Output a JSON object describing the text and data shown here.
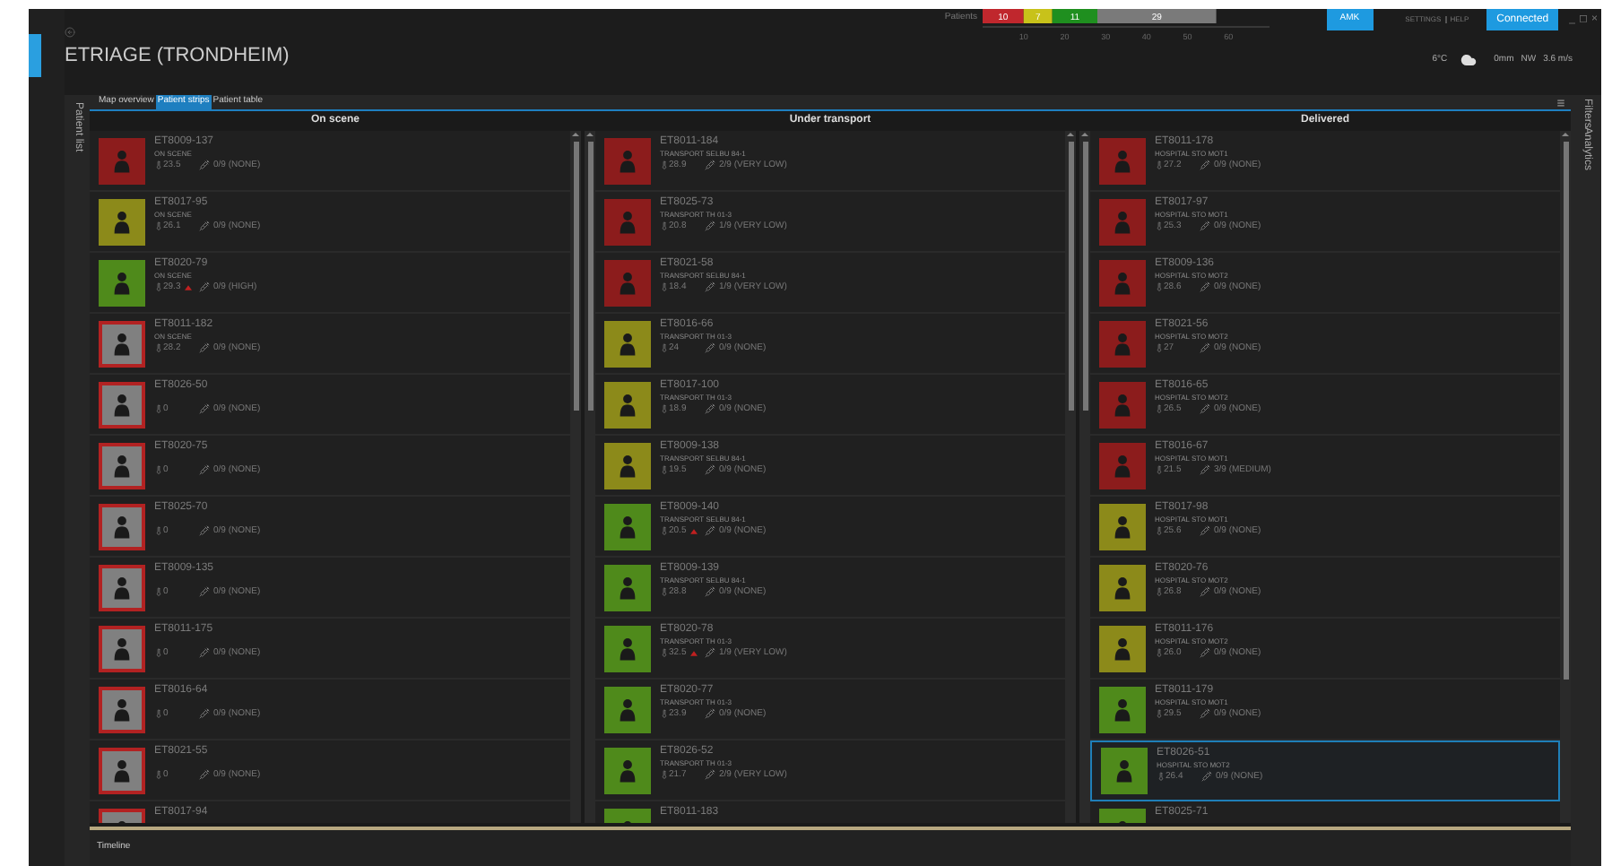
{
  "header": {
    "title": "ETRIAGE (TRONDHEIM)",
    "chart_data": {
      "type": "bar",
      "orientation": "horizontal",
      "stacked": true,
      "data_labels": true,
      "categories": [
        "Patients"
      ],
      "xlim": [
        0,
        70
      ],
      "xticks": [
        10,
        20,
        30,
        40,
        50,
        60
      ],
      "series": [
        {
          "color": "#c0272d",
          "values": [
            10
          ]
        },
        {
          "color": "#c8c21a",
          "values": [
            7
          ]
        },
        {
          "color": "#1f8f1f",
          "values": [
            11
          ]
        },
        {
          "color": "#7a7a7a",
          "values": [
            29
          ]
        }
      ]
    },
    "amk_button": "AMK",
    "links": [
      "SETTINGS",
      "HELP"
    ],
    "connection": "Connected",
    "window_controls": [
      "_",
      "◻",
      "×"
    ],
    "weather": {
      "temperature": "6°C",
      "precipitation": "0mm",
      "wind_direction": "NW",
      "wind_speed": "3.6 m/s"
    }
  },
  "left_side_tabs": [
    "Patient list"
  ],
  "right_side_tabs": [
    "Filters",
    "Analytics"
  ],
  "tabs": [
    {
      "label": "Map overview",
      "selected": false
    },
    {
      "label": "Patient strips",
      "selected": true
    },
    {
      "label": "Patient table",
      "selected": false
    }
  ],
  "columns": [
    {
      "title": "On scene",
      "patients": [
        {
          "id": "ET8009-137",
          "status": "ON SCENE",
          "temp": "23.5",
          "score": "0/9 (NONE)",
          "flagged": false,
          "color": "#8c1c1c",
          "outlined": false,
          "selected": false
        },
        {
          "id": "ET8017-95",
          "status": "ON SCENE",
          "temp": "26.1",
          "score": "0/9 (NONE)",
          "flagged": false,
          "color": "#8c8a1a",
          "outlined": false,
          "selected": false
        },
        {
          "id": "ET8020-79",
          "status": "ON SCENE",
          "temp": "29.3",
          "score": "0/9 (HIGH)",
          "flagged": true,
          "color": "#4f8a1b",
          "outlined": false,
          "selected": false
        },
        {
          "id": "ET8011-182",
          "status": "ON SCENE",
          "temp": "28.2",
          "score": "0/9 (NONE)",
          "flagged": false,
          "color": "#808080",
          "outlined": true,
          "selected": false
        },
        {
          "id": "ET8026-50",
          "temp": "0",
          "score": "0/9 (NONE)",
          "flagged": false,
          "color": "#808080",
          "outlined": true,
          "selected": false
        },
        {
          "id": "ET8020-75",
          "temp": "0",
          "score": "0/9 (NONE)",
          "flagged": false,
          "color": "#808080",
          "outlined": true,
          "selected": false
        },
        {
          "id": "ET8025-70",
          "temp": "0",
          "score": "0/9 (NONE)",
          "flagged": false,
          "color": "#808080",
          "outlined": true,
          "selected": false
        },
        {
          "id": "ET8009-135",
          "temp": "0",
          "score": "0/9 (NONE)",
          "flagged": false,
          "color": "#808080",
          "outlined": true,
          "selected": false
        },
        {
          "id": "ET8011-175",
          "temp": "0",
          "score": "0/9 (NONE)",
          "flagged": false,
          "color": "#808080",
          "outlined": true,
          "selected": false
        },
        {
          "id": "ET8016-64",
          "temp": "0",
          "score": "0/9 (NONE)",
          "flagged": false,
          "color": "#808080",
          "outlined": true,
          "selected": false
        },
        {
          "id": "ET8021-55",
          "temp": "0",
          "score": "0/9 (NONE)",
          "flagged": false,
          "color": "#808080",
          "outlined": true,
          "selected": false
        },
        {
          "id": "ET8017-94",
          "color": "#808080",
          "outlined": true,
          "selected": false
        }
      ]
    },
    {
      "title": "Under transport",
      "patients": [
        {
          "id": "ET8011-184",
          "status": "TRANSPORT SELBU 84-1",
          "temp": "28.9",
          "score": "2/9 (VERY LOW)",
          "flagged": false,
          "color": "#8c1c1c",
          "outlined": false,
          "selected": false
        },
        {
          "id": "ET8025-73",
          "status": "TRANSPORT TH 01-3",
          "temp": "20.8",
          "score": "1/9 (VERY LOW)",
          "flagged": false,
          "color": "#8c1c1c",
          "outlined": false,
          "selected": false
        },
        {
          "id": "ET8021-58",
          "status": "TRANSPORT SELBU 84-1",
          "temp": "18.4",
          "score": "1/9 (VERY LOW)",
          "flagged": false,
          "color": "#8c1c1c",
          "outlined": false,
          "selected": false
        },
        {
          "id": "ET8016-66",
          "status": "TRANSPORT TH 01-3",
          "temp": "24",
          "score": "0/9 (NONE)",
          "flagged": false,
          "color": "#8c8a1a",
          "outlined": false,
          "selected": false
        },
        {
          "id": "ET8017-100",
          "status": "TRANSPORT TH 01-3",
          "temp": "18.9",
          "score": "0/9 (NONE)",
          "flagged": false,
          "color": "#8c8a1a",
          "outlined": false,
          "selected": false
        },
        {
          "id": "ET8009-138",
          "status": "TRANSPORT SELBU 84-1",
          "temp": "19.5",
          "score": "0/9 (NONE)",
          "flagged": false,
          "color": "#8c8a1a",
          "outlined": false,
          "selected": false
        },
        {
          "id": "ET8009-140",
          "status": "TRANSPORT SELBU 84-1",
          "temp": "20.5",
          "score": "0/9 (NONE)",
          "flagged": true,
          "color": "#4f8a1b",
          "outlined": false,
          "selected": false
        },
        {
          "id": "ET8009-139",
          "status": "TRANSPORT SELBU 84-1",
          "temp": "28.8",
          "score": "0/9 (NONE)",
          "flagged": false,
          "color": "#4f8a1b",
          "outlined": false,
          "selected": false
        },
        {
          "id": "ET8020-78",
          "status": "TRANSPORT TH 01-3",
          "temp": "32.5",
          "score": "1/9 (VERY LOW)",
          "flagged": true,
          "color": "#4f8a1b",
          "outlined": false,
          "selected": false
        },
        {
          "id": "ET8020-77",
          "status": "TRANSPORT TH 01-3",
          "temp": "23.9",
          "score": "0/9 (NONE)",
          "flagged": false,
          "color": "#4f8a1b",
          "outlined": false,
          "selected": false
        },
        {
          "id": "ET8026-52",
          "status": "TRANSPORT TH 01-3",
          "temp": "21.7",
          "score": "2/9 (VERY LOW)",
          "flagged": false,
          "color": "#4f8a1b",
          "outlined": false,
          "selected": false
        },
        {
          "id": "ET8011-183",
          "color": "#4f8a1b",
          "outlined": false,
          "selected": false
        }
      ]
    },
    {
      "title": "Delivered",
      "patients": [
        {
          "id": "ET8011-178",
          "status": "HOSPITAL STO MOT1",
          "temp": "27.2",
          "score": "0/9 (NONE)",
          "flagged": false,
          "color": "#8c1c1c",
          "outlined": false,
          "selected": false
        },
        {
          "id": "ET8017-97",
          "status": "HOSPITAL STO MOT1",
          "temp": "25.3",
          "score": "0/9 (NONE)",
          "flagged": false,
          "color": "#8c1c1c",
          "outlined": false,
          "selected": false
        },
        {
          "id": "ET8009-136",
          "status": "HOSPITAL STO MOT2",
          "temp": "28.6",
          "score": "0/9 (NONE)",
          "flagged": false,
          "color": "#8c1c1c",
          "outlined": false,
          "selected": false
        },
        {
          "id": "ET8021-56",
          "status": "HOSPITAL STO MOT2",
          "temp": "27",
          "score": "0/9 (NONE)",
          "flagged": false,
          "color": "#8c1c1c",
          "outlined": false,
          "selected": false
        },
        {
          "id": "ET8016-65",
          "status": "HOSPITAL STO MOT2",
          "temp": "26.5",
          "score": "0/9 (NONE)",
          "flagged": false,
          "color": "#8c1c1c",
          "outlined": false,
          "selected": false
        },
        {
          "id": "ET8016-67",
          "status": "HOSPITAL STO MOT1",
          "temp": "21.5",
          "score": "3/9 (MEDIUM)",
          "flagged": false,
          "color": "#8c1c1c",
          "outlined": false,
          "selected": false
        },
        {
          "id": "ET8017-98",
          "status": "HOSPITAL STO MOT1",
          "temp": "25.6",
          "score": "0/9 (NONE)",
          "flagged": false,
          "color": "#8c8a1a",
          "outlined": false,
          "selected": false
        },
        {
          "id": "ET8020-76",
          "status": "HOSPITAL STO MOT2",
          "temp": "26.8",
          "score": "0/9 (NONE)",
          "flagged": false,
          "color": "#8c8a1a",
          "outlined": false,
          "selected": false
        },
        {
          "id": "ET8011-176",
          "status": "HOSPITAL STO MOT2",
          "temp": "26.0",
          "score": "0/9 (NONE)",
          "flagged": false,
          "color": "#8c8a1a",
          "outlined": false,
          "selected": false
        },
        {
          "id": "ET8011-179",
          "status": "HOSPITAL STO MOT1",
          "temp": "29.5",
          "score": "0/9 (NONE)",
          "flagged": false,
          "color": "#4f8a1b",
          "outlined": false,
          "selected": false
        },
        {
          "id": "ET8026-51",
          "status": "HOSPITAL STO MOT2",
          "temp": "26.4",
          "score": "0/9 (NONE)",
          "flagged": false,
          "color": "#4f8a1b",
          "outlined": false,
          "selected": true
        },
        {
          "id": "ET8025-71",
          "color": "#4f8a1b",
          "outlined": false,
          "selected": false
        }
      ]
    }
  ],
  "timeline": {
    "label": "Timeline"
  }
}
